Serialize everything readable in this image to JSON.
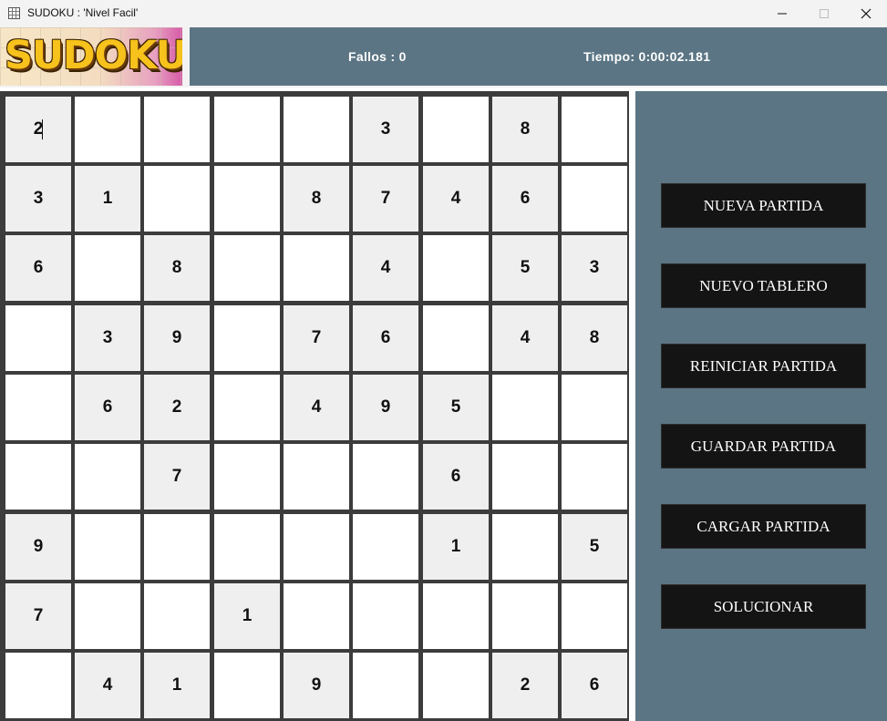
{
  "window": {
    "title": "SUDOKU : 'Nivel Facil'",
    "icon": "sudoku-grid-icon",
    "controls": [
      "minimize-icon",
      "maximize-icon",
      "close-icon"
    ]
  },
  "header": {
    "logo_text": "SUDOKU",
    "fallos": "Fallos : 0",
    "tiempo": "Tiempo: 0:00:02.181"
  },
  "board": {
    "rows": [
      [
        "2",
        "",
        "",
        "",
        "",
        "3",
        "",
        "8",
        ""
      ],
      [
        "3",
        "1",
        "",
        "",
        "8",
        "7",
        "4",
        "6",
        ""
      ],
      [
        "6",
        "",
        "8",
        "",
        "",
        "4",
        "",
        "5",
        "3"
      ],
      [
        "",
        "3",
        "9",
        "",
        "7",
        "6",
        "",
        "4",
        "8"
      ],
      [
        "",
        "6",
        "2",
        "",
        "4",
        "9",
        "5",
        "",
        ""
      ],
      [
        "",
        "",
        "7",
        "",
        "",
        "",
        "6",
        "",
        ""
      ],
      [
        "9",
        "",
        "",
        "",
        "",
        "",
        "1",
        "",
        "5"
      ],
      [
        "7",
        "",
        "",
        "1",
        "",
        "",
        "",
        "",
        ""
      ],
      [
        "",
        "4",
        "1",
        "",
        "9",
        "",
        "",
        "2",
        "6"
      ]
    ],
    "focused_cell": [
      0,
      0
    ],
    "colors": {
      "given": "#efefef",
      "empty": "#ffffff",
      "lines": "#3c3c3c"
    }
  },
  "buttons": [
    {
      "id": "nueva-partida",
      "label": "NUEVA PARTIDA"
    },
    {
      "id": "nuevo-tablero",
      "label": "NUEVO TABLERO"
    },
    {
      "id": "reiniciar-partida",
      "label": "REINICIAR PARTIDA"
    },
    {
      "id": "guardar-partida",
      "label": "GUARDAR PARTIDA"
    },
    {
      "id": "cargar-partida",
      "label": "CARGAR PARTIDA"
    },
    {
      "id": "solucionar",
      "label": "SOLUCIONAR"
    }
  ],
  "colors": {
    "panel": "#5b7584",
    "button": "#141414",
    "button_text": "#ffffff"
  }
}
